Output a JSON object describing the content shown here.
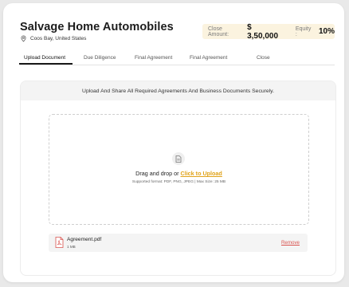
{
  "header": {
    "title": "Salvage Home Automobiles",
    "location": "Coos Bay, United States",
    "close_amount_label": "Close Amount:",
    "close_amount_value": "$ 3,50,000",
    "equity_label": "Equity :",
    "equity_value": "10%"
  },
  "tabs": [
    {
      "label": "Upload Document",
      "active": true
    },
    {
      "label": "Due Diligence",
      "active": false
    },
    {
      "label": "Final Agreement",
      "active": false
    },
    {
      "label": "Final Agreement",
      "active": false
    },
    {
      "label": "Close",
      "active": false
    }
  ],
  "upload": {
    "header_text": "Upload And Share All Required Agreements And Business Documents Securely.",
    "drag_text": "Drag and drop or",
    "click_text": "Click to Upload",
    "format_text": "Supported format: PDF, PNG, JPEG  |  Max Size: 25 MB"
  },
  "file": {
    "name": "Agreement.pdf",
    "size": "1 MB",
    "remove_label": "Remove"
  },
  "colors": {
    "accent": "#e0a31b",
    "remove": "#d9534f",
    "deal_box_bg": "#fbf3df"
  }
}
